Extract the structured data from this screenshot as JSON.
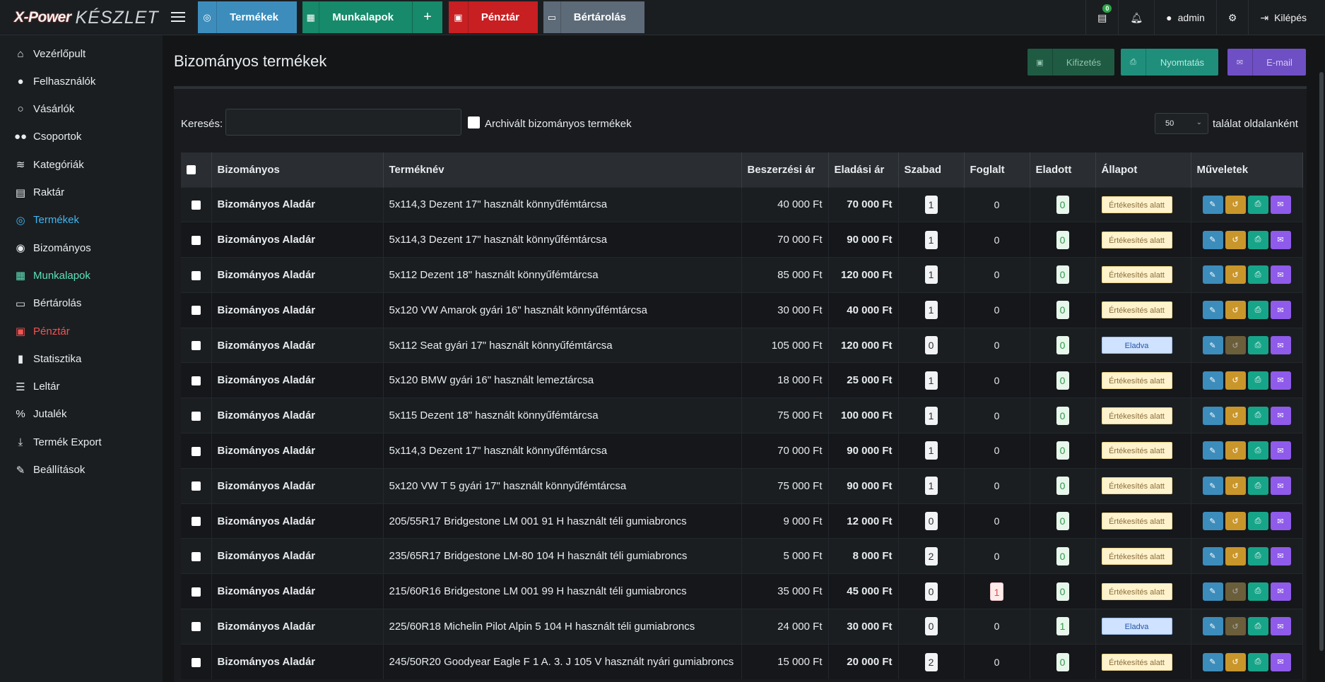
{
  "app": {
    "brand": "X-Power",
    "name": "KÉSZLET"
  },
  "topnav": {
    "termekek": "Termékek",
    "munkalapok": "Munkalapok",
    "plus": "+",
    "penztar": "Pénztár",
    "bertarolas": "Bértárolás"
  },
  "topright": {
    "badge_count": "0",
    "user": "admin",
    "logout": "Kilépés"
  },
  "sidebar": [
    {
      "label": "Vezérlőpult",
      "icon": "home-icon",
      "glyph": "⌂",
      "color": "#e9ecef"
    },
    {
      "label": "Felhasználók",
      "icon": "user-icon",
      "glyph": "●",
      "color": "#e9ecef"
    },
    {
      "label": "Vásárlók",
      "icon": "user-outline-icon",
      "glyph": "○",
      "color": "#e9ecef"
    },
    {
      "label": "Csoportok",
      "icon": "users-icon",
      "glyph": "●●",
      "color": "#e9ecef"
    },
    {
      "label": "Kategóriák",
      "icon": "layers-icon",
      "glyph": "≋",
      "color": "#e9ecef"
    },
    {
      "label": "Raktár",
      "icon": "warehouse-icon",
      "glyph": "▤",
      "color": "#e9ecef"
    },
    {
      "label": "Termékek",
      "icon": "tire-icon",
      "glyph": "◎",
      "color": "#3fb7f0"
    },
    {
      "label": "Bizományos",
      "icon": "user-circle-icon",
      "glyph": "◉",
      "color": "#e9ecef"
    },
    {
      "label": "Munkalapok",
      "icon": "file-icon",
      "glyph": "▦",
      "color": "#5ee0b8"
    },
    {
      "label": "Bértárolás",
      "icon": "archive-icon",
      "glyph": "▭",
      "color": "#e9ecef"
    },
    {
      "label": "Pénztár",
      "icon": "money-icon",
      "glyph": "▣",
      "color": "#f05454"
    },
    {
      "label": "Statisztika",
      "icon": "chart-icon",
      "glyph": "▮",
      "color": "#e9ecef"
    },
    {
      "label": "Leltár",
      "icon": "list-icon",
      "glyph": "☰",
      "color": "#e9ecef"
    },
    {
      "label": "Jutalék",
      "icon": "percent-icon",
      "glyph": "%",
      "color": "#e9ecef"
    },
    {
      "label": "Termék Export",
      "icon": "download-icon",
      "glyph": "⤓",
      "color": "#e9ecef"
    },
    {
      "label": "Beállítások",
      "icon": "wrench-icon",
      "glyph": "✎",
      "color": "#e9ecef"
    }
  ],
  "page": {
    "title": "Bizományos termékek",
    "btn_kifizetes": "Kifizetés",
    "btn_nyomtatas": "Nyomtatás",
    "btn_email": "E-mail"
  },
  "filters": {
    "search_label": "Keresés:",
    "search_value": "",
    "archive_label": "Archivált bizományos termékek",
    "per_page_value": "50",
    "per_page_label": "találat oldalanként"
  },
  "table": {
    "headers": [
      "Bizományos",
      "Terméknév",
      "Beszerzési ár",
      "Eladási ár",
      "Szabad",
      "Foglalt",
      "Eladott",
      "Állapot",
      "Műveletek"
    ],
    "rows": [
      {
        "owner": "Bizományos Aladár",
        "product": "5x114,3 Dezent 17\" használt könnyűfémtárcsa",
        "buy": "40 000 Ft",
        "sell": "70 000 Ft",
        "free": "1",
        "reserved": "0",
        "sold": "0",
        "status": "Értékesítés alatt",
        "status_type": "pending"
      },
      {
        "owner": "Bizományos Aladár",
        "product": "5x114,3 Dezent 17\" használt könnyűfémtárcsa",
        "buy": "70 000 Ft",
        "sell": "90 000 Ft",
        "free": "1",
        "reserved": "0",
        "sold": "0",
        "status": "Értékesítés alatt",
        "status_type": "pending"
      },
      {
        "owner": "Bizományos Aladár",
        "product": "5x112 Dezent 18\" használt könnyűfémtárcsa",
        "buy": "85 000 Ft",
        "sell": "120 000 Ft",
        "free": "1",
        "reserved": "0",
        "sold": "0",
        "status": "Értékesítés alatt",
        "status_type": "pending"
      },
      {
        "owner": "Bizományos Aladár",
        "product": "5x120 VW Amarok gyári 16\" használt könnyűfémtárcsa",
        "buy": "30 000 Ft",
        "sell": "40 000 Ft",
        "free": "1",
        "reserved": "0",
        "sold": "0",
        "status": "Értékesítés alatt",
        "status_type": "pending"
      },
      {
        "owner": "Bizományos Aladár",
        "product": "5x112 Seat gyári 17\" használt könnyűfémtárcsa",
        "buy": "105 000 Ft",
        "sell": "120 000 Ft",
        "free": "0",
        "reserved": "0",
        "sold": "0",
        "status": "Eladva",
        "status_type": "sold"
      },
      {
        "owner": "Bizományos Aladár",
        "product": "5x120 BMW gyári 16\" használt lemeztárcsa",
        "buy": "18 000 Ft",
        "sell": "25 000 Ft",
        "free": "1",
        "reserved": "0",
        "sold": "0",
        "status": "Értékesítés alatt",
        "status_type": "pending"
      },
      {
        "owner": "Bizományos Aladár",
        "product": "5x115 Dezent 18\" használt könnyűfémtárcsa",
        "buy": "75 000 Ft",
        "sell": "100 000 Ft",
        "free": "1",
        "reserved": "0",
        "sold": "0",
        "status": "Értékesítés alatt",
        "status_type": "pending"
      },
      {
        "owner": "Bizományos Aladár",
        "product": "5x114,3 Dezent 17\" használt könnyűfémtárcsa",
        "buy": "70 000 Ft",
        "sell": "90 000 Ft",
        "free": "1",
        "reserved": "0",
        "sold": "0",
        "status": "Értékesítés alatt",
        "status_type": "pending"
      },
      {
        "owner": "Bizományos Aladár",
        "product": "5x120 VW T 5 gyári 17\" használt könnyűfémtárcsa",
        "buy": "75 000 Ft",
        "sell": "90 000 Ft",
        "free": "1",
        "reserved": "0",
        "sold": "0",
        "status": "Értékesítés alatt",
        "status_type": "pending"
      },
      {
        "owner": "Bizományos Aladár",
        "product": "205/55R17 Bridgestone LM 001 91 H használt téli gumiabroncs",
        "buy": "9 000 Ft",
        "sell": "12 000 Ft",
        "free": "0",
        "reserved": "0",
        "sold": "0",
        "status": "Értékesítés alatt",
        "status_type": "pending"
      },
      {
        "owner": "Bizományos Aladár",
        "product": "235/65R17 Bridgestone LM-80 104 H használt téli gumiabroncs",
        "buy": "5 000 Ft",
        "sell": "8 000 Ft",
        "free": "2",
        "reserved": "0",
        "sold": "0",
        "status": "Értékesítés alatt",
        "status_type": "pending"
      },
      {
        "owner": "Bizományos Aladár",
        "product": "215/60R16 Bridgestone LM 001 99 H használt téli gumiabroncs",
        "buy": "35 000 Ft",
        "sell": "45 000 Ft",
        "free": "0",
        "reserved": "1",
        "sold": "0",
        "status": "Értékesítés alatt",
        "status_type": "pending"
      },
      {
        "owner": "Bizományos Aladár",
        "product": "225/60R18 Michelin Pilot Alpin 5 104 H használt téli gumiabroncs",
        "buy": "24 000 Ft",
        "sell": "30 000 Ft",
        "free": "0",
        "reserved": "0",
        "sold": "1",
        "status": "Eladva",
        "status_type": "sold"
      },
      {
        "owner": "Bizományos Aladár",
        "product": "245/50R20 Goodyear Eagle F 1 A. 3. J 105 V használt nyári gumiabroncs",
        "buy": "15 000 Ft",
        "sell": "20 000 Ft",
        "free": "2",
        "reserved": "0",
        "sold": "0",
        "status": "Értékesítés alatt",
        "status_type": "pending"
      }
    ]
  },
  "colors": {
    "primary": "#3c8dbc",
    "success": "#168a6a",
    "danger": "#c71f22",
    "secondary": "#5d6a78",
    "active_link": "#3fb7f0"
  }
}
